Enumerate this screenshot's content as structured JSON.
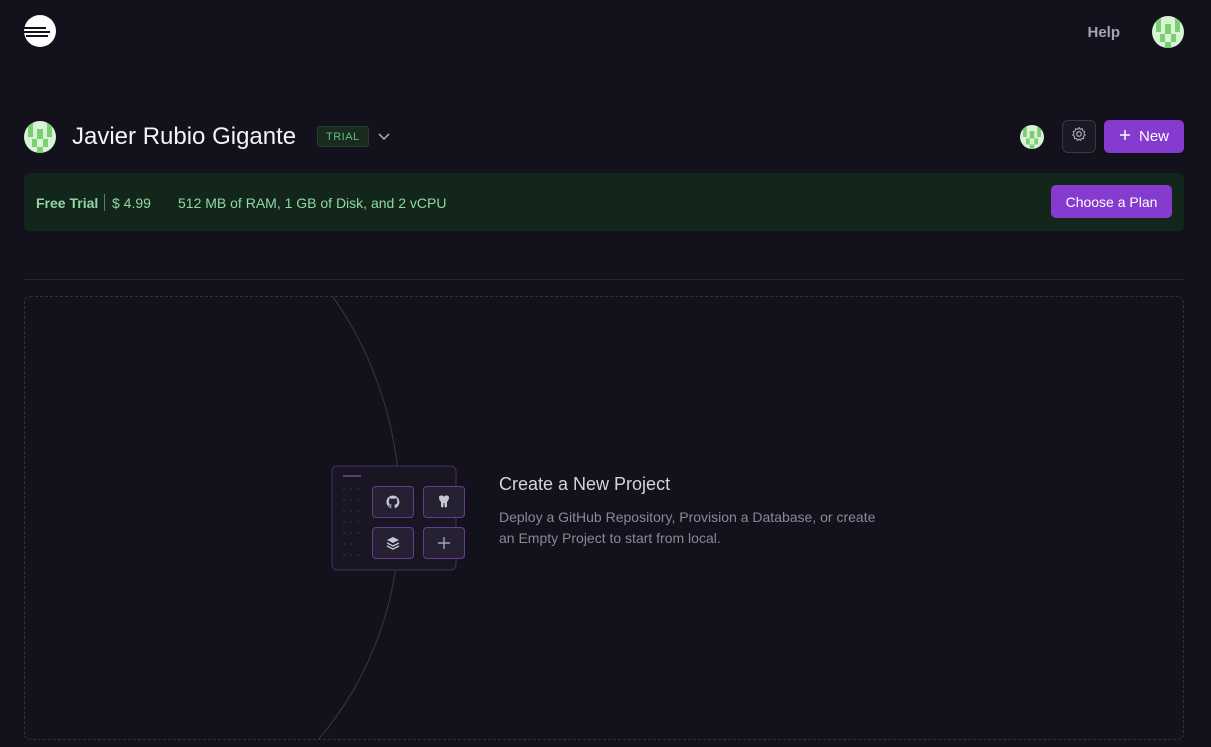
{
  "topbar": {
    "logo_icon": "railway-logo-icon",
    "help_label": "Help",
    "avatar_icon": "user-avatar-icon"
  },
  "workspace": {
    "name": "Javier Rubio Gigante",
    "badge": "TRIAL",
    "chevron_icon": "chevron-down-icon",
    "settings_icon": "gear-icon",
    "new_button_label": "New",
    "new_icon": "plus-icon"
  },
  "trial_banner": {
    "label": "Free Trial",
    "price": "$ 4.99",
    "specs": "512 MB of RAM, 1 GB of Disk, and 2 vCPU",
    "cta_label": "Choose a Plan"
  },
  "empty_state": {
    "title": "Create a New Project",
    "description": "Deploy a GitHub Repository, Provision a Database, or create an Empty Project to start from local.",
    "tiles": [
      "github-icon",
      "postgres-icon",
      "template-stack-icon",
      "plus-icon"
    ]
  },
  "colors": {
    "background": "#13111c",
    "accent": "#853bce",
    "trial_green": "#8ed8a3",
    "banner_bg": "#13261c"
  }
}
